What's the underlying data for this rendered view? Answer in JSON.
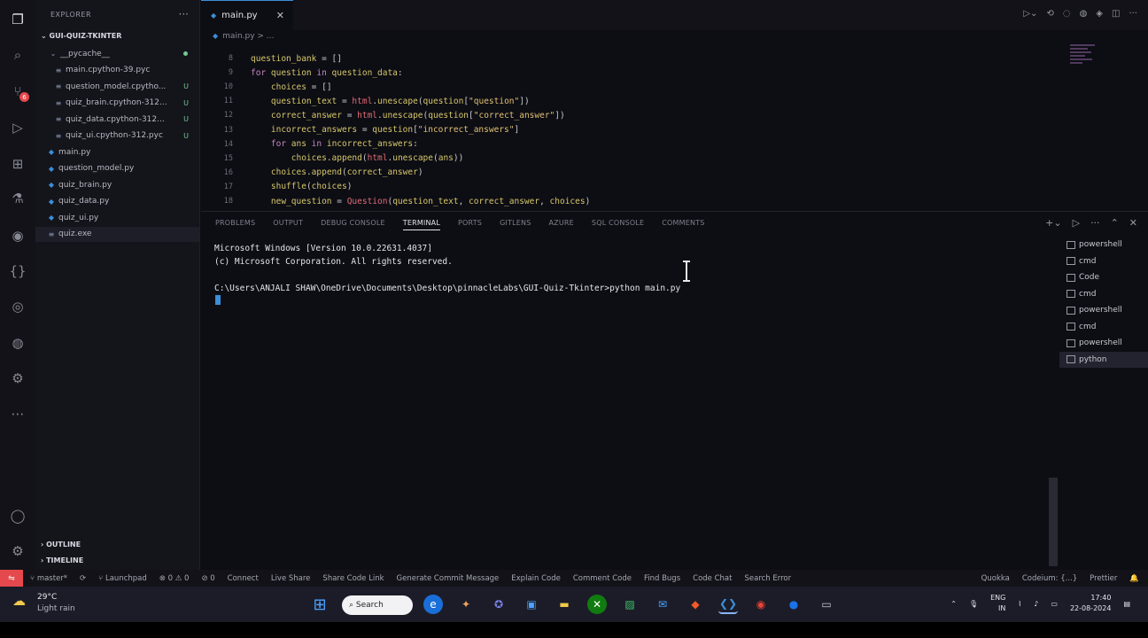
{
  "sidebar": {
    "title": "EXPLORER",
    "project": "GUI-QUIZ-TKINTER",
    "files": [
      {
        "name": "__pycache__",
        "kind": "folder",
        "status": "•"
      },
      {
        "name": "main.cpython-39.pyc",
        "kind": "pyc",
        "status": ""
      },
      {
        "name": "question_model.cpytho...",
        "kind": "pyc",
        "status": "U"
      },
      {
        "name": "quiz_brain.cpython-312...",
        "kind": "pyc",
        "status": "U"
      },
      {
        "name": "quiz_data.cpython-312...",
        "kind": "pyc",
        "status": "U"
      },
      {
        "name": "quiz_ui.cpython-312.pyc",
        "kind": "pyc",
        "status": "U"
      },
      {
        "name": "main.py",
        "kind": "py",
        "status": ""
      },
      {
        "name": "question_model.py",
        "kind": "py",
        "status": ""
      },
      {
        "name": "quiz_brain.py",
        "kind": "py",
        "status": ""
      },
      {
        "name": "quiz_data.py",
        "kind": "py",
        "status": ""
      },
      {
        "name": "quiz_ui.py",
        "kind": "py",
        "status": ""
      },
      {
        "name": "quiz.exe",
        "kind": "exe",
        "status": ""
      }
    ],
    "outline": "OUTLINE",
    "timeline": "TIMELINE"
  },
  "editor": {
    "tab": "main.py",
    "breadcrumb": "main.py > ...",
    "lines": [
      {
        "n": "8",
        "indent": "",
        "parts": [
          [
            "var",
            "question_bank"
          ],
          [
            "pl",
            " = []"
          ]
        ]
      },
      {
        "n": "9",
        "indent": "",
        "parts": [
          [
            "kw",
            "for "
          ],
          [
            "var",
            "question "
          ],
          [
            "kw",
            "in "
          ],
          [
            "var",
            "question_data"
          ],
          [
            "pl",
            ":"
          ]
        ]
      },
      {
        "n": "10",
        "indent": "    ",
        "parts": [
          [
            "var",
            "choices"
          ],
          [
            "pl",
            " = []"
          ]
        ]
      },
      {
        "n": "11",
        "indent": "    ",
        "parts": [
          [
            "var",
            "question_text"
          ],
          [
            "pl",
            " = "
          ],
          [
            "fn",
            "html"
          ],
          [
            "pl",
            "."
          ],
          [
            "var",
            "unescape"
          ],
          [
            "pl",
            "("
          ],
          [
            "var",
            "question"
          ],
          [
            "pl",
            "["
          ],
          [
            "str",
            "\"question\""
          ],
          [
            "pl",
            "])"
          ]
        ]
      },
      {
        "n": "12",
        "indent": "    ",
        "parts": [
          [
            "var",
            "correct_answer"
          ],
          [
            "pl",
            " = "
          ],
          [
            "fn",
            "html"
          ],
          [
            "pl",
            "."
          ],
          [
            "var",
            "unescape"
          ],
          [
            "pl",
            "("
          ],
          [
            "var",
            "question"
          ],
          [
            "pl",
            "["
          ],
          [
            "str",
            "\"correct_answer\""
          ],
          [
            "pl",
            "])"
          ]
        ]
      },
      {
        "n": "13",
        "indent": "    ",
        "parts": [
          [
            "var",
            "incorrect_answers"
          ],
          [
            "pl",
            " = "
          ],
          [
            "var",
            "question"
          ],
          [
            "pl",
            "["
          ],
          [
            "str",
            "\"incorrect_answers\""
          ],
          [
            "pl",
            "]"
          ]
        ]
      },
      {
        "n": "14",
        "indent": "    ",
        "parts": [
          [
            "kw",
            "for "
          ],
          [
            "var",
            "ans "
          ],
          [
            "kw",
            "in "
          ],
          [
            "var",
            "incorrect_answers"
          ],
          [
            "pl",
            ":"
          ]
        ]
      },
      {
        "n": "15",
        "indent": "        ",
        "parts": [
          [
            "var",
            "choices"
          ],
          [
            "pl",
            "."
          ],
          [
            "var",
            "append"
          ],
          [
            "pl",
            "("
          ],
          [
            "fn",
            "html"
          ],
          [
            "pl",
            "."
          ],
          [
            "var",
            "unescape"
          ],
          [
            "pl",
            "("
          ],
          [
            "var",
            "ans"
          ],
          [
            "pl",
            "))"
          ]
        ]
      },
      {
        "n": "16",
        "indent": "    ",
        "parts": [
          [
            "var",
            "choices"
          ],
          [
            "pl",
            "."
          ],
          [
            "var",
            "append"
          ],
          [
            "pl",
            "("
          ],
          [
            "var",
            "correct_answer"
          ],
          [
            "pl",
            ")"
          ]
        ]
      },
      {
        "n": "17",
        "indent": "    ",
        "parts": [
          [
            "var",
            "shuffle"
          ],
          [
            "pl",
            "("
          ],
          [
            "var",
            "choices"
          ],
          [
            "pl",
            ")"
          ]
        ]
      },
      {
        "n": "18",
        "indent": "    ",
        "parts": [
          [
            "var",
            "new_question"
          ],
          [
            "pl",
            " = "
          ],
          [
            "fn",
            "Question"
          ],
          [
            "pl",
            "("
          ],
          [
            "var",
            "question_text"
          ],
          [
            "pl",
            ", "
          ],
          [
            "var",
            "correct_answer"
          ],
          [
            "pl",
            ", "
          ],
          [
            "var",
            "choices"
          ],
          [
            "pl",
            ")"
          ]
        ]
      }
    ]
  },
  "panel": {
    "tabs": [
      "PROBLEMS",
      "OUTPUT",
      "DEBUG CONSOLE",
      "TERMINAL",
      "PORTS",
      "GITLENS",
      "AZURE",
      "SQL CONSOLE",
      "COMMENTS"
    ],
    "active_tab": "TERMINAL",
    "terminal_lines": [
      "Microsoft Windows [Version 10.0.22631.4037]",
      "(c) Microsoft Corporation. All rights reserved.",
      "",
      "C:\\Users\\ANJALI SHAW\\OneDrive\\Documents\\Desktop\\pinnacleLabs\\GUI-Quiz-Tkinter>python main.py"
    ],
    "terminals": [
      "powershell",
      "cmd",
      "Code",
      "cmd",
      "powershell",
      "cmd",
      "powershell",
      "python"
    ],
    "selected_terminal": 7
  },
  "status": {
    "branch": "master*",
    "launchpad": "Launchpad",
    "problems": "⊗ 0 ⚠ 0",
    "ports": "⊘ 0",
    "items": [
      "Connect",
      "Live Share",
      "Share Code Link",
      "Generate Commit Message",
      "Explain Code",
      "Comment Code",
      "Find Bugs",
      "Code Chat",
      "Search Error"
    ],
    "right": [
      "Quokka",
      "Codeium: {...}",
      "Prettier"
    ]
  },
  "taskbar": {
    "temp": "29°C",
    "condition": "Light rain",
    "search": "Search",
    "lang": "ENG",
    "region": "IN",
    "time": "17:40",
    "date": "22-08-2024"
  },
  "colors": {
    "accent": "#3b8ed8",
    "error": "#e5484d",
    "git_untracked": "#73c991"
  }
}
